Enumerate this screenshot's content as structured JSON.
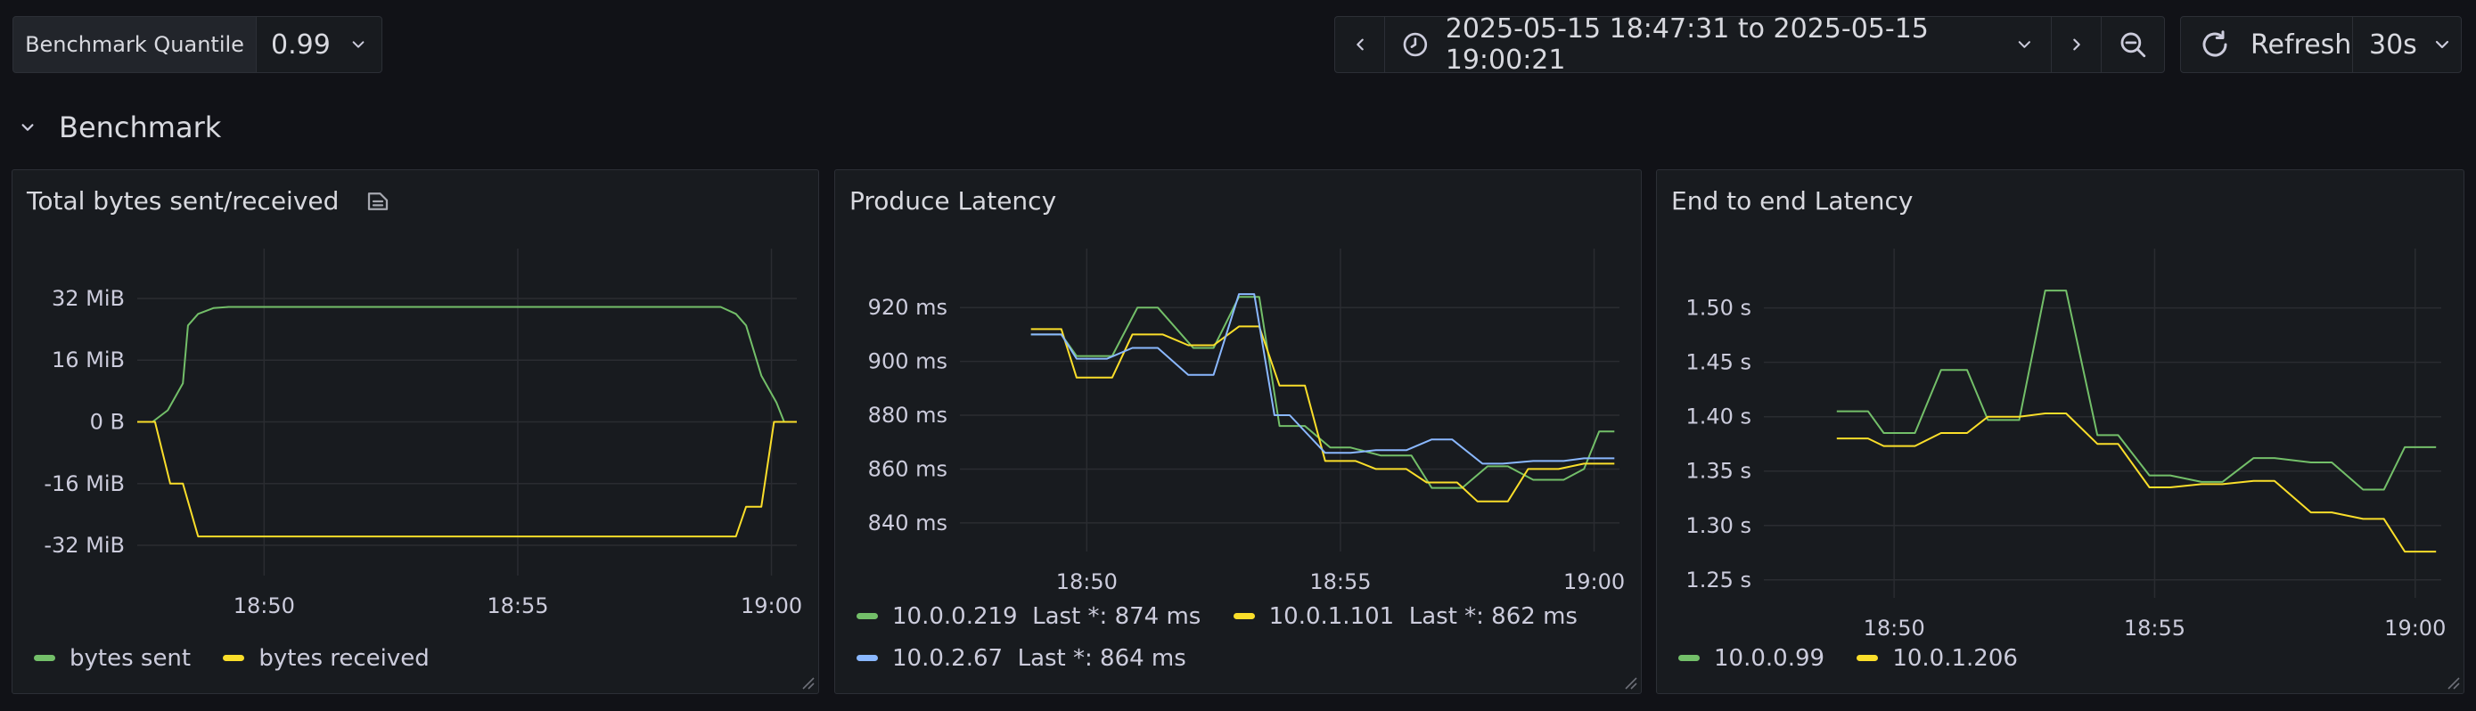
{
  "variable": {
    "label": "Benchmark Quantile",
    "value": "0.99"
  },
  "time_range": {
    "label": "2025-05-15 18:47:31 to 2025-05-15 19:00:21"
  },
  "refresh": {
    "label": "Refresh",
    "interval": "30s"
  },
  "row": {
    "title": "Benchmark"
  },
  "colors": {
    "green": "#73bf69",
    "yellow": "#fade2a",
    "blue": "#8ab8ff",
    "grid": "#2a2c31",
    "axis_text": "#ccccdc"
  },
  "panels": [
    {
      "title": "Total bytes sent/received",
      "legend": [
        {
          "label": "bytes sent",
          "color": "#73bf69"
        },
        {
          "label": "bytes received",
          "color": "#fade2a"
        }
      ]
    },
    {
      "title": "Produce Latency",
      "legend": [
        {
          "label": "10.0.0.219",
          "last": "Last *: 874 ms",
          "color": "#73bf69"
        },
        {
          "label": "10.0.1.101",
          "last": "Last *: 862 ms",
          "color": "#fade2a"
        },
        {
          "label": "10.0.2.67",
          "last": "Last *: 864 ms",
          "color": "#8ab8ff"
        }
      ]
    },
    {
      "title": "End to end Latency",
      "legend": [
        {
          "label": "10.0.0.99",
          "color": "#73bf69"
        },
        {
          "label": "10.0.1.206",
          "color": "#fade2a"
        }
      ]
    }
  ],
  "chart_data": [
    {
      "type": "line",
      "title": "Total bytes sent/received",
      "x_ticks": [
        "18:50",
        "18:55",
        "19:00"
      ],
      "x_tick_values": [
        2.5,
        7.5,
        12.5
      ],
      "y_ticks": [
        "32 MiB",
        "16 MiB",
        "0 B",
        "-16 MiB",
        "-32 MiB"
      ],
      "y_tick_values": [
        32,
        16,
        0,
        -16,
        -32
      ],
      "xlim": [
        0,
        13.0
      ],
      "ylim": [
        -38,
        38
      ],
      "series": [
        {
          "name": "bytes sent",
          "color": "#73bf69",
          "x": [
            0.0,
            0.3,
            0.6,
            0.9,
            1.0,
            1.2,
            1.5,
            1.8,
            2.0,
            3.0,
            4.0,
            5.0,
            6.0,
            7.0,
            8.0,
            9.0,
            10.0,
            11.0,
            11.5,
            11.8,
            12.0,
            12.3,
            12.6,
            12.75,
            13.0
          ],
          "y": [
            0,
            0,
            3,
            10,
            25,
            28,
            29.5,
            29.8,
            29.8,
            29.8,
            29.8,
            29.8,
            29.8,
            29.8,
            29.8,
            29.8,
            29.8,
            29.8,
            29.8,
            28,
            25,
            12,
            5,
            0,
            0
          ]
        },
        {
          "name": "bytes received",
          "color": "#fade2a",
          "x": [
            0.0,
            0.35,
            0.65,
            0.9,
            1.2,
            1.5,
            2.0,
            3.0,
            4.0,
            5.0,
            6.0,
            7.0,
            8.0,
            9.0,
            10.0,
            11.0,
            11.5,
            11.8,
            12.0,
            12.3,
            12.55,
            12.75,
            13.0
          ],
          "y": [
            0,
            0,
            -16,
            -16,
            -29.7,
            -29.7,
            -29.7,
            -29.7,
            -29.7,
            -29.7,
            -29.7,
            -29.7,
            -29.7,
            -29.7,
            -29.7,
            -29.7,
            -29.7,
            -29.7,
            -22,
            -22,
            0,
            0,
            0
          ]
        }
      ]
    },
    {
      "type": "line",
      "title": "Produce Latency",
      "x_ticks": [
        "18:50",
        "18:55",
        "19:00"
      ],
      "x_tick_values": [
        2.5,
        7.5,
        12.5
      ],
      "y_ticks": [
        "920 ms",
        "900 ms",
        "880 ms",
        "860 ms",
        "840 ms"
      ],
      "y_tick_values": [
        920,
        900,
        880,
        860,
        840
      ],
      "xlim": [
        0,
        13.0
      ],
      "ylim": [
        832,
        932
      ],
      "series": [
        {
          "name": "10.0.0.219",
          "color": "#73bf69",
          "x": [
            1.4,
            2.0,
            2.3,
            3.0,
            3.5,
            3.9,
            4.6,
            5.0,
            5.5,
            5.9,
            6.3,
            6.8,
            7.3,
            7.7,
            8.3,
            8.9,
            9.3,
            9.9,
            10.4,
            10.8,
            11.3,
            11.9,
            12.3,
            12.6,
            12.9
          ],
          "y": [
            910,
            910,
            902,
            902,
            920,
            920,
            905,
            905,
            924,
            924,
            876,
            876,
            868,
            868,
            865,
            865,
            853,
            853,
            861,
            861,
            856,
            856,
            860,
            874,
            874
          ]
        },
        {
          "name": "10.0.1.101",
          "color": "#fade2a",
          "x": [
            1.4,
            2.0,
            2.3,
            3.0,
            3.4,
            4.0,
            4.5,
            5.0,
            5.5,
            5.9,
            6.3,
            6.8,
            7.2,
            7.8,
            8.2,
            8.8,
            9.2,
            9.8,
            10.2,
            10.8,
            11.2,
            11.8,
            12.3,
            12.7,
            12.9
          ],
          "y": [
            912,
            912,
            894,
            894,
            910,
            910,
            906,
            906,
            913,
            913,
            891,
            891,
            863,
            863,
            860,
            860,
            855,
            855,
            848,
            848,
            860,
            860,
            862,
            862,
            862
          ]
        },
        {
          "name": "10.0.2.67",
          "color": "#8ab8ff",
          "x": [
            1.4,
            2.0,
            2.3,
            2.9,
            3.4,
            3.9,
            4.5,
            5.0,
            5.5,
            5.8,
            6.2,
            6.5,
            7.2,
            7.7,
            8.2,
            8.8,
            9.3,
            9.7,
            10.3,
            10.7,
            11.3,
            11.9,
            12.3,
            12.9
          ],
          "y": [
            910,
            910,
            901,
            901,
            905,
            905,
            895,
            895,
            925,
            925,
            880,
            880,
            866,
            866,
            867,
            867,
            871,
            871,
            862,
            862,
            863,
            863,
            864,
            864
          ]
        }
      ]
    },
    {
      "type": "line",
      "title": "End to end Latency",
      "x_ticks": [
        "18:50",
        "18:55",
        "19:00"
      ],
      "x_tick_values": [
        2.5,
        7.5,
        12.5
      ],
      "y_ticks": [
        "1.50 s",
        "1.45 s",
        "1.40 s",
        "1.35 s",
        "1.30 s",
        "1.25 s"
      ],
      "y_tick_values": [
        1.5,
        1.45,
        1.4,
        1.35,
        1.3,
        1.25
      ],
      "xlim": [
        0,
        13.0
      ],
      "ylim": [
        1.24,
        1.53
      ],
      "series": [
        {
          "name": "10.0.0.99",
          "color": "#73bf69",
          "x": [
            1.4,
            2.0,
            2.3,
            2.9,
            3.4,
            3.9,
            4.3,
            4.9,
            5.4,
            5.8,
            6.4,
            6.8,
            7.4,
            7.8,
            8.4,
            8.8,
            9.4,
            9.8,
            10.5,
            10.9,
            11.5,
            11.9,
            12.3,
            12.9
          ],
          "y": [
            1.405,
            1.405,
            1.385,
            1.385,
            1.443,
            1.443,
            1.397,
            1.397,
            1.516,
            1.516,
            1.383,
            1.383,
            1.346,
            1.346,
            1.34,
            1.34,
            1.362,
            1.362,
            1.358,
            1.358,
            1.333,
            1.333,
            1.372,
            1.372
          ]
        },
        {
          "name": "10.0.1.206",
          "color": "#fade2a",
          "x": [
            1.4,
            2.0,
            2.3,
            2.9,
            3.4,
            3.9,
            4.3,
            4.9,
            5.4,
            5.8,
            6.4,
            6.8,
            7.4,
            7.8,
            8.4,
            8.8,
            9.4,
            9.8,
            10.5,
            10.9,
            11.5,
            11.9,
            12.3,
            12.9
          ],
          "y": [
            1.38,
            1.38,
            1.373,
            1.373,
            1.385,
            1.385,
            1.4,
            1.4,
            1.403,
            1.403,
            1.375,
            1.375,
            1.335,
            1.335,
            1.338,
            1.338,
            1.341,
            1.341,
            1.312,
            1.312,
            1.306,
            1.306,
            1.276,
            1.276
          ]
        }
      ]
    }
  ]
}
